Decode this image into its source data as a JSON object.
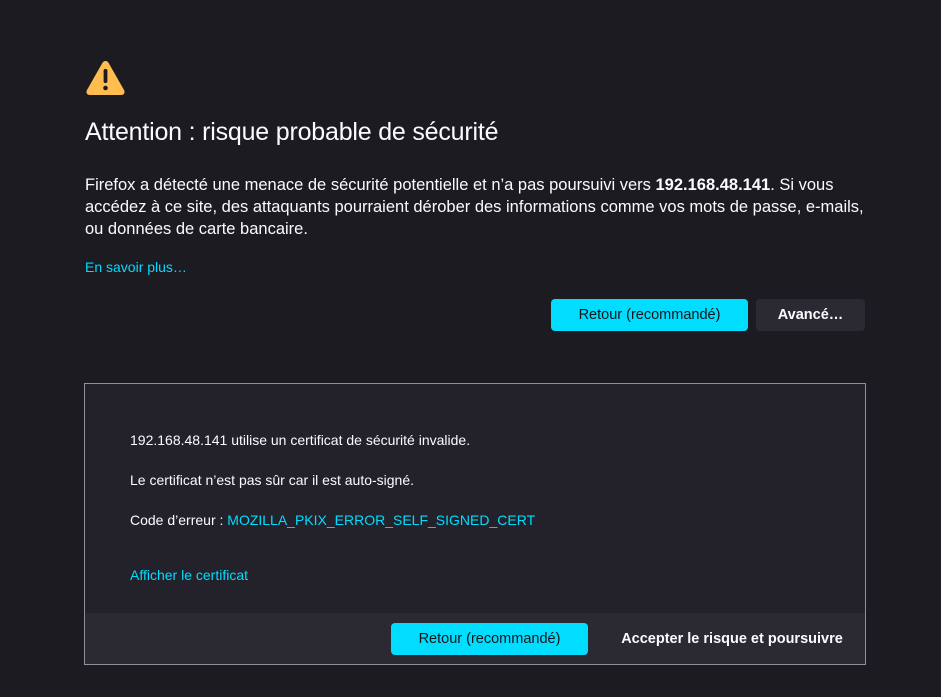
{
  "header": {
    "icon": "warning-triangle-icon",
    "title": "Attention : risque probable de sécurité"
  },
  "description": {
    "part1": "Firefox a détecté une menace de sécurité potentielle et n’a pas poursuivi vers ",
    "host": "192.168.48.141",
    "part2": ". Si vous accédez à ce site, des attaquants pourraient dérober des informations comme vos mots de passe, e-mails, ou données de carte bancaire."
  },
  "learn_more": "En savoir plus…",
  "actions": {
    "back_label": "Retour (recommandé)",
    "advanced_label": "Avancé…"
  },
  "advanced": {
    "line1": "192.168.48.141 utilise un certificat de sécurité invalide.",
    "line2": "Le certificat n’est pas sûr car il est auto-signé.",
    "error_prefix": "Code d’erreur : ",
    "error_code": "MOZILLA_PKIX_ERROR_SELF_SIGNED_CERT",
    "view_certificate": "Afficher le certificat",
    "back_label": "Retour (recommandé)",
    "accept_label": "Accepter le risque et poursuivre"
  },
  "colors": {
    "background": "#1c1b22",
    "accent": "#00ddff",
    "warning": "#ffbd4f",
    "panel": "#23222b",
    "footer": "#2b2a33"
  }
}
